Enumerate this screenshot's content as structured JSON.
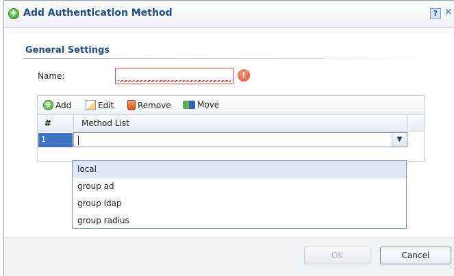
{
  "dialog": {
    "title": "Add Authentication Method",
    "help_label": "?",
    "close_label": "✕"
  },
  "general": {
    "section_title": "General Settings",
    "name_label": "Name:",
    "name_value": "",
    "error_glyph": "!"
  },
  "toolbar": {
    "add_label": "Add",
    "edit_label": "Edit",
    "remove_label": "Remove",
    "move_label": "Move"
  },
  "table": {
    "columns": [
      "#",
      "Method List"
    ],
    "rows": [
      {
        "index": "1",
        "method": ""
      }
    ]
  },
  "dropdown": {
    "options": [
      "local",
      "group ad",
      "group ldap",
      "group radius"
    ],
    "highlighted": "local"
  },
  "footer": {
    "ok_label": "OK",
    "cancel_label": "Cancel"
  },
  "colors": {
    "accent": "#1f4e8c",
    "selection": "#3f74c4",
    "error": "#e14b4b"
  }
}
